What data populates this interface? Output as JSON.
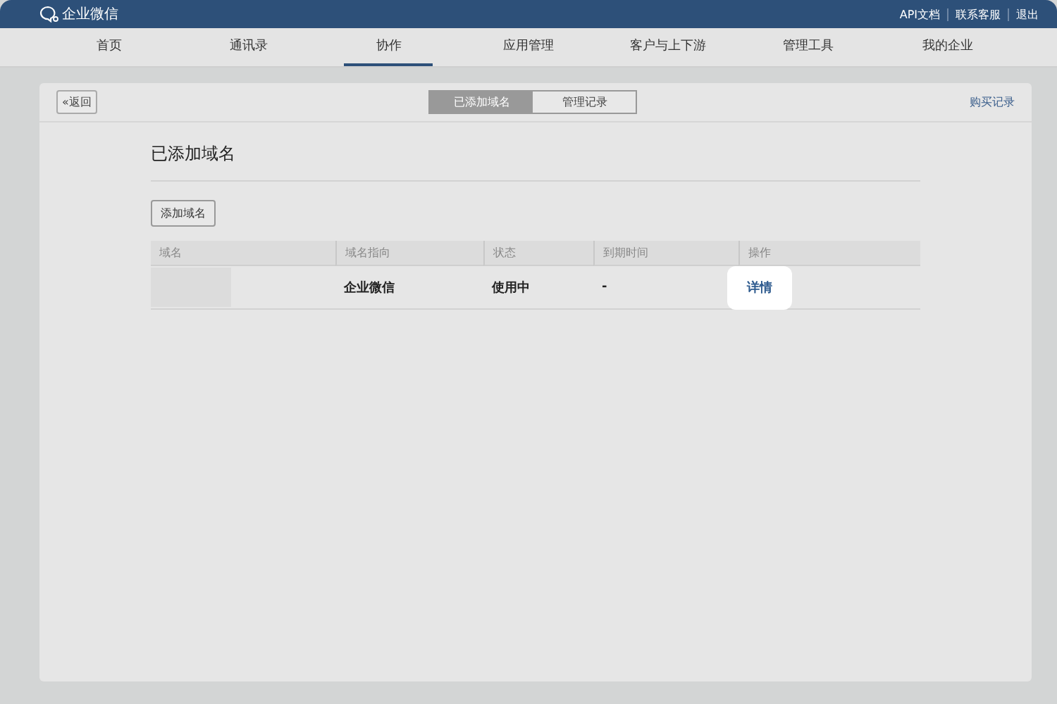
{
  "header": {
    "logo": "企业微信",
    "links": [
      "API文档",
      "联系客服",
      "退出"
    ]
  },
  "nav": [
    {
      "label": "首页",
      "selected": false
    },
    {
      "label": "通讯录",
      "selected": false
    },
    {
      "label": "协作",
      "selected": true
    },
    {
      "label": "应用管理",
      "selected": false
    },
    {
      "label": "客户与上下游",
      "selected": false
    },
    {
      "label": "管理工具",
      "selected": false
    },
    {
      "label": "我的企业",
      "selected": false
    }
  ],
  "toolbar": {
    "back": "«返回",
    "tabs": [
      {
        "label": "已添加域名",
        "selected": true
      },
      {
        "label": "管理记录",
        "selected": false
      }
    ],
    "link": "购买记录"
  },
  "section_title": "已添加域名",
  "add_button": "添加域名",
  "table": {
    "columns": [
      "域名",
      "域名指向",
      "状态",
      "到期时间",
      "操作"
    ],
    "rows": [
      {
        "target": "企业微信",
        "status": "使用中",
        "expiry": "-",
        "action": "详情"
      }
    ]
  }
}
